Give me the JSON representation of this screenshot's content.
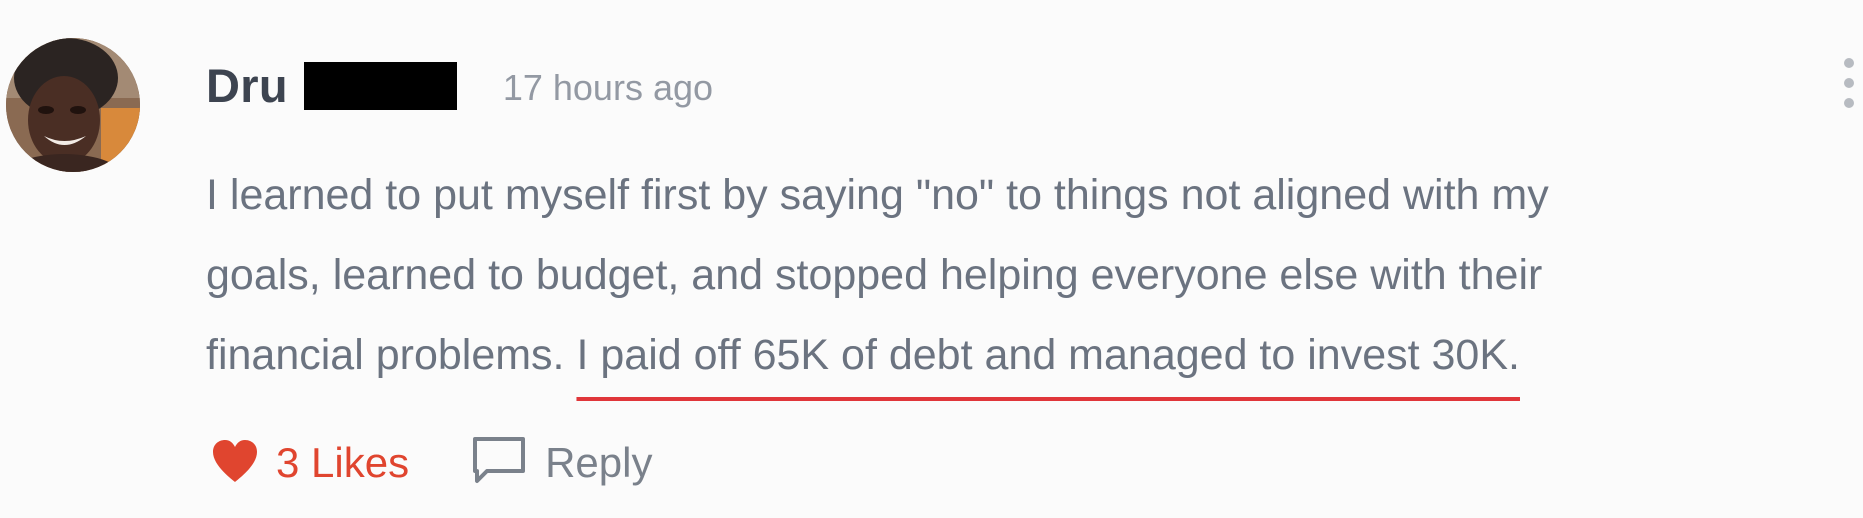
{
  "comment": {
    "author": {
      "name": "Dru",
      "surname_redacted": true
    },
    "timestamp": "17 hours ago",
    "body": {
      "line1": "I learned to put myself first by saying \"no\" to things not aligned with my",
      "line2": "goals, learned to budget, and stopped helping everyone else with their",
      "line3_plain": "financial problems. ",
      "line3_highlight": "I paid off 65K of debt and managed to invest 30K."
    },
    "actions": {
      "likes_label": "3 Likes",
      "reply_label": "Reply"
    },
    "icons": {
      "like": "heart-icon",
      "reply": "speech-bubble-icon",
      "menu": "more-vertical-icon"
    },
    "colors": {
      "like_accent": "#e0452f",
      "highlight_underline": "#e0363a",
      "text": "#6b7380",
      "author": "#3d4450"
    }
  }
}
